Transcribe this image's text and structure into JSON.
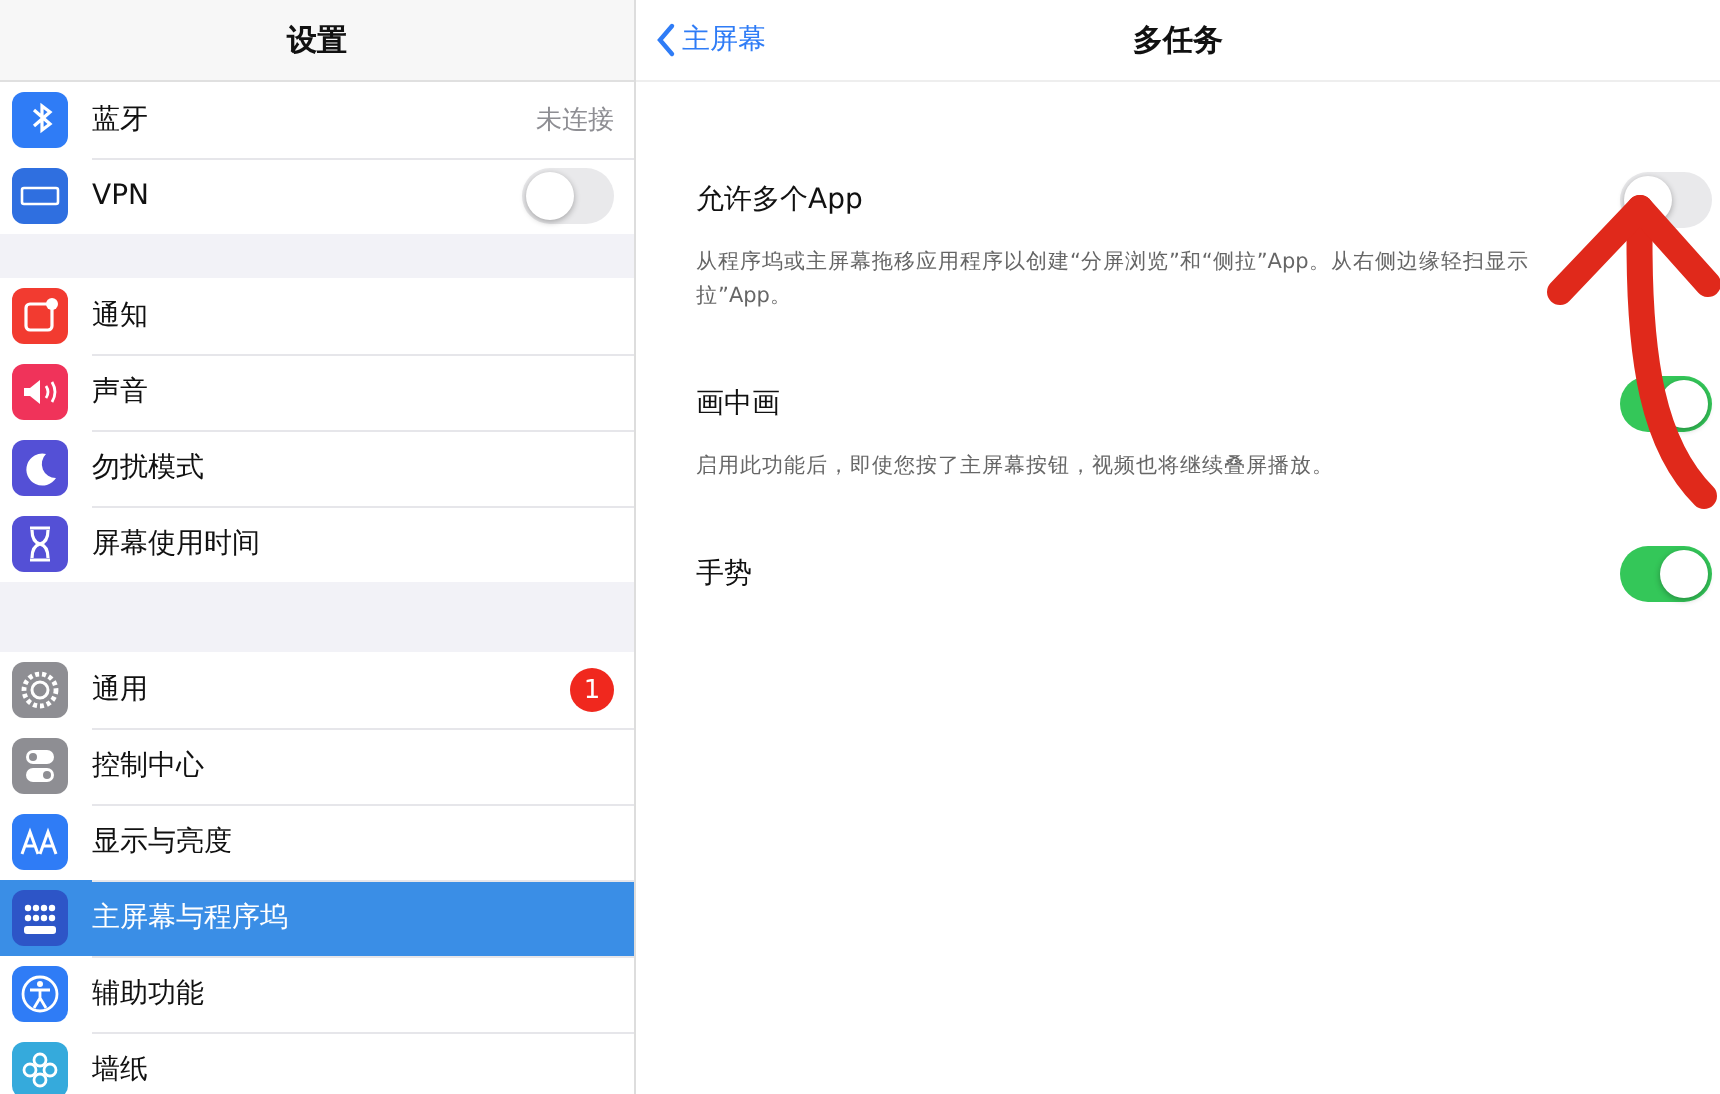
{
  "sidebar": {
    "title": "设置",
    "groups": [
      [
        {
          "kind": "value",
          "label": "蓝牙",
          "value": "未连接",
          "selected": false
        },
        {
          "kind": "toggle",
          "label": "VPN",
          "on": false,
          "selected": false
        }
      ],
      [
        {
          "kind": "link",
          "label": "通知",
          "selected": false
        },
        {
          "kind": "link",
          "label": "声音",
          "selected": false
        },
        {
          "kind": "link",
          "label": "勿扰模式",
          "selected": false
        },
        {
          "kind": "link",
          "label": "屏幕使用时间",
          "selected": false
        }
      ],
      [
        {
          "kind": "badge",
          "label": "通用",
          "badge": "1",
          "selected": false
        },
        {
          "kind": "link",
          "label": "控制中心",
          "selected": false
        },
        {
          "kind": "link",
          "label": "显示与亮度",
          "selected": false
        },
        {
          "kind": "link",
          "label": "主屏幕与程序坞",
          "selected": true
        },
        {
          "kind": "link",
          "label": "辅助功能",
          "selected": false
        },
        {
          "kind": "link",
          "label": "墙纸",
          "selected": false
        }
      ]
    ]
  },
  "detail": {
    "back": "主屏幕",
    "title": "多任务",
    "settings": [
      {
        "label": "允许多个App",
        "on": false,
        "description_lines": [
          "从程序坞或主屏幕拖移应用程序以创建“分屏浏览”和“侧拉”App。从右侧边缘轻扫显示",
          "拉”App。"
        ]
      },
      {
        "label": "画中画",
        "on": true,
        "description_lines": [
          "启用此功能后，即使您按了主屏幕按钮，视频也将继续叠屏播放。"
        ]
      },
      {
        "label": "手势",
        "on": true
      }
    ]
  }
}
